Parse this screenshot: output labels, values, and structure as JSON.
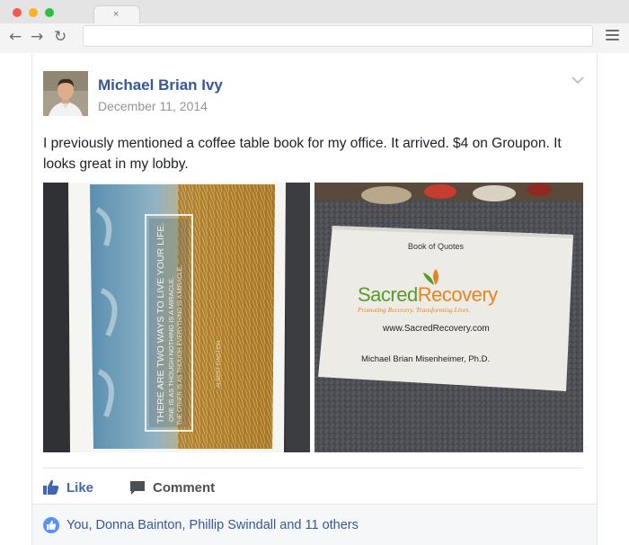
{
  "browser": {
    "tab_close": "×",
    "back_icon": "←",
    "forward_icon": "→",
    "reload_icon": "↻"
  },
  "post": {
    "author": "Michael Brian Ivy",
    "date": "December 11, 2014",
    "text": "I previously mentioned a coffee table book for my office. It arrived. $4 on Groupon. It looks great in my lobby.",
    "photo1": {
      "quote_line1": "THERE ARE TWO WAYS TO LIVE YOUR LIFE.",
      "quote_line2": "ONE IS AS THOUGH NOTHING IS A MIRACLE.",
      "quote_line3": "THE OTHER IS AS THOUGH EVERYTHING IS A MIRACLE.",
      "quote_author": "ALBERT EINSTEIN"
    },
    "photo2": {
      "card_header": "Book of Quotes",
      "brand_part1": "Sacred",
      "brand_part2": "Recovery",
      "tagline": "Promoting Recovery. Transforming Lives.",
      "website": "www.SacredRecovery.com",
      "card_author": "Michael Brian Misenheimer, Ph.D."
    },
    "actions": {
      "like": "Like",
      "comment": "Comment"
    },
    "reactions": "You, Donna Bainton, Phillip Swindall and 11 others"
  },
  "colors": {
    "link_blue": "#365899",
    "like_blue": "#4267b2",
    "brand_green": "#5a9a2c",
    "brand_orange": "#e8841f"
  }
}
